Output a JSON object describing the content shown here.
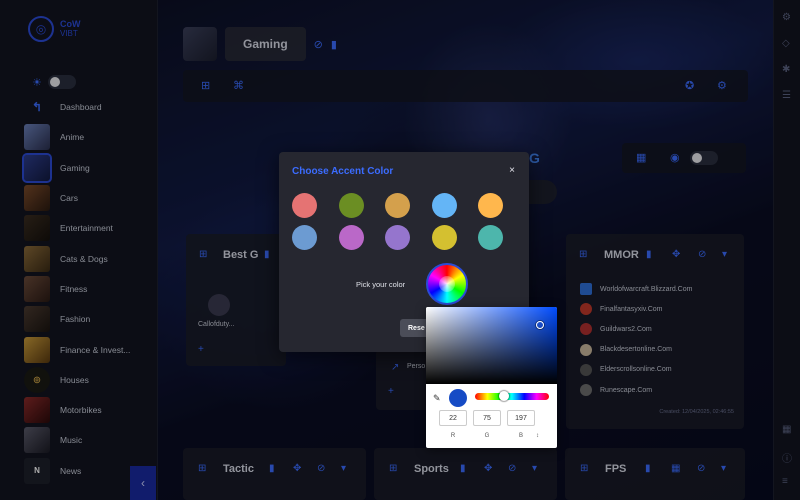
{
  "app": {
    "logo_line1": "CoW",
    "logo_line2": "VIBT"
  },
  "sidebar": {
    "items": [
      {
        "label": "Dashboard",
        "thumb": "back-arrow-icon"
      },
      {
        "label": "Anime"
      },
      {
        "label": "Gaming",
        "active": true
      },
      {
        "label": "Cars"
      },
      {
        "label": "Entertainment"
      },
      {
        "label": "Cats & Dogs"
      },
      {
        "label": "Fitness"
      },
      {
        "label": "Fashion"
      },
      {
        "label": "Finance & Invest..."
      },
      {
        "label": "Houses"
      },
      {
        "label": "Motorbikes"
      },
      {
        "label": "Music"
      },
      {
        "label": "News",
        "letter": "N"
      }
    ],
    "collapse_icon": "chevron-left-icon"
  },
  "header": {
    "title": "Gaming"
  },
  "cards": {
    "best": {
      "title": "Best G",
      "item_label": "Callofduty..."
    },
    "mmorpg": {
      "title": "MMOR",
      "sites": [
        {
          "label": "Worldofwarcraft.Blizzard.Com",
          "color": "#2f6fd8"
        },
        {
          "label": "Finalfantasyxiv.Com",
          "color": "#c0392b"
        },
        {
          "label": "Guildwars2.Com",
          "color": "#b03030"
        },
        {
          "label": "Blackdesertonline.Com",
          "color": "#c9b79c"
        },
        {
          "label": "Elderscrollsonline.Com",
          "color": "#555555"
        },
        {
          "label": "Runescape.Com",
          "color": "#6e6e6e"
        }
      ],
      "created": "Created: 12/04/2025, 02:46:55"
    },
    "middle": {
      "item_label": "Perso"
    },
    "tactic": {
      "title": "Tactic"
    },
    "sports": {
      "title": "Sports"
    },
    "fps": {
      "title": "FPS"
    }
  },
  "accent_dialog": {
    "title": "Choose Accent Color",
    "close": "×",
    "swatches": [
      "#e57373",
      "#6b8e23",
      "#d4a04c",
      "#64b5f6",
      "#ffb74d",
      "#6c9bd2",
      "#ba68c8",
      "#9575cd",
      "#d4c030",
      "#4db6ac"
    ],
    "pick_label": "Pick your color",
    "reset_label": "Rese"
  },
  "color_picker": {
    "r": "22",
    "g": "75",
    "b": "197",
    "label_r": "R",
    "label_g": "G",
    "label_b": "B",
    "spin": "↕"
  }
}
